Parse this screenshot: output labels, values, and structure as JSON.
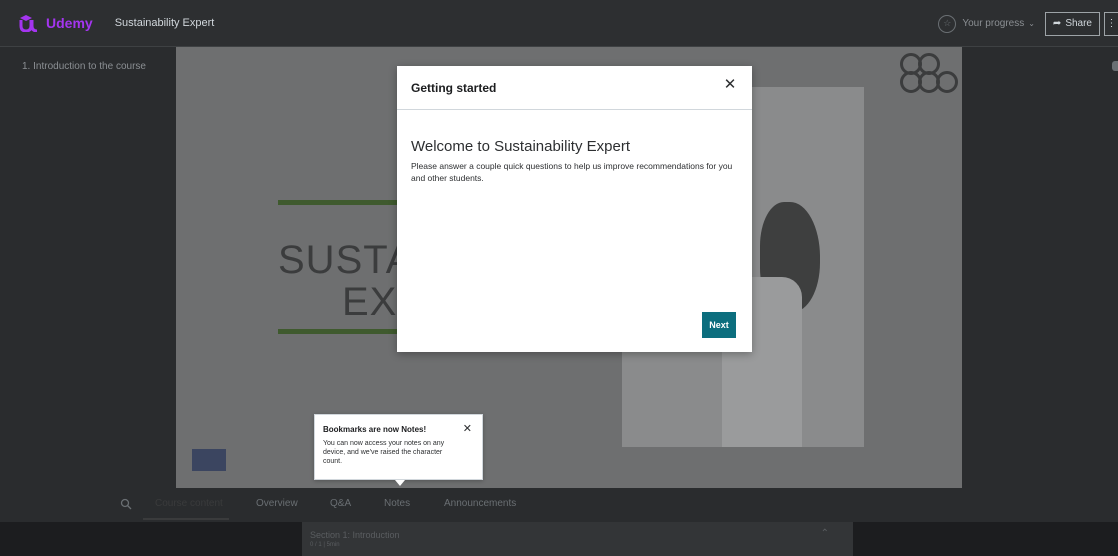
{
  "header": {
    "logo_text": "Udemy",
    "course_title": "Sustainability Expert",
    "progress_label": "Your progress",
    "share_label": "Share"
  },
  "stage": {
    "lecture_label": "1. Introduction to the course"
  },
  "slide": {
    "title_line1": "SUSTAIN",
    "title_line2": "EXP"
  },
  "tabs": [
    {
      "label": "Course content",
      "active": true
    },
    {
      "label": "Overview",
      "active": false
    },
    {
      "label": "Q&A",
      "active": false
    },
    {
      "label": "Notes",
      "active": false
    },
    {
      "label": "Announcements",
      "active": false
    }
  ],
  "section": {
    "title": "Section 1: Introduction",
    "subtitle": "0 / 1 | 5min"
  },
  "modal": {
    "title": "Getting started",
    "heading": "Welcome to Sustainability Expert",
    "body": "Please answer a couple quick questions to help us improve recommendations for you and other students.",
    "next_label": "Next"
  },
  "popover": {
    "title": "Bookmarks are now Notes!",
    "body": "You can now access your notes on any device, and we've raised the character count."
  },
  "colors": {
    "brand": "#a435f0",
    "accent_button": "#0c6e7e",
    "topbar": "#2d2f31"
  }
}
